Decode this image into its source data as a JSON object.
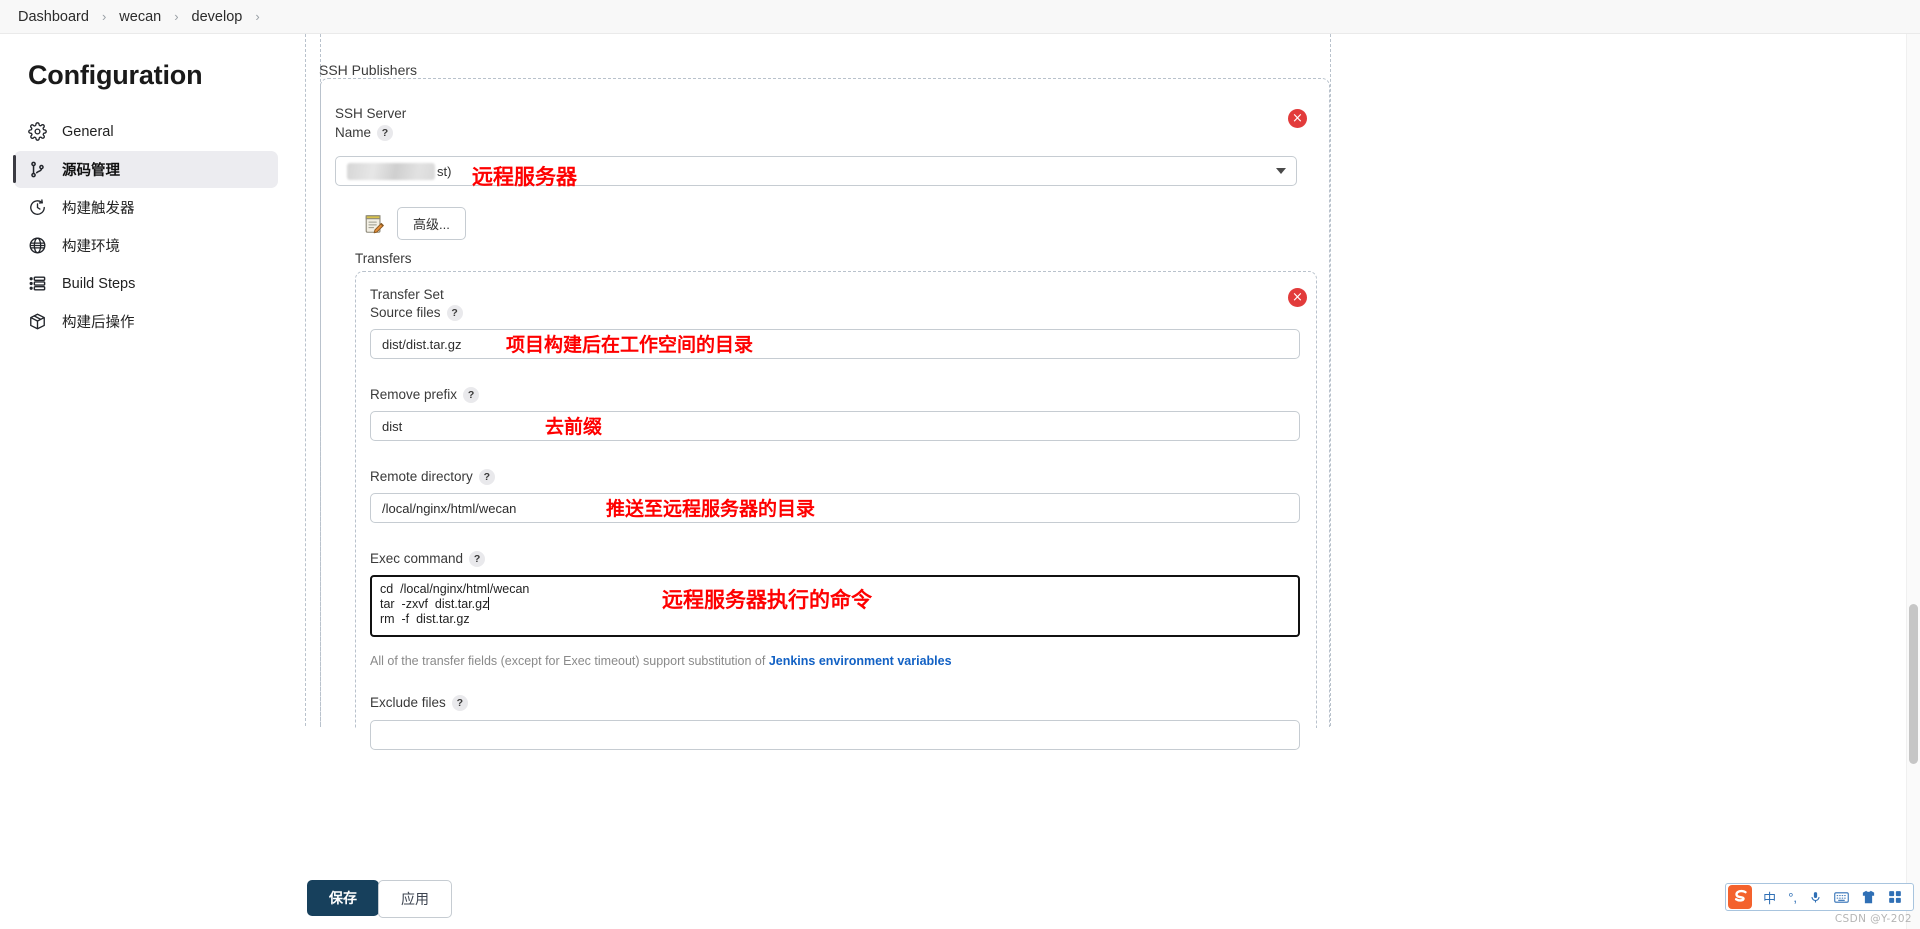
{
  "breadcrumb": {
    "items": [
      {
        "label": "Dashboard"
      },
      {
        "label": "wecan"
      },
      {
        "label": "develop"
      }
    ],
    "separator": "›"
  },
  "sidebar": {
    "title": "Configuration",
    "items": [
      {
        "label": "General",
        "icon": "gear-icon",
        "active": false
      },
      {
        "label": "源码管理",
        "icon": "source-branch-icon",
        "active": true
      },
      {
        "label": "构建触发器",
        "icon": "clock-icon",
        "active": false
      },
      {
        "label": "构建环境",
        "icon": "globe-icon",
        "active": false
      },
      {
        "label": "Build Steps",
        "icon": "list-steps-icon",
        "active": false
      },
      {
        "label": "构建后操作",
        "icon": "package-icon",
        "active": false
      }
    ]
  },
  "main": {
    "section_title": "SSH Publishers",
    "ssh_server": {
      "label_line1": "SSH Server",
      "label_line2": "Name",
      "help": "?",
      "selected_value_tail": "st)",
      "selected_value_redacted": true,
      "annotation": "远程服务器",
      "close_label": "×"
    },
    "advanced_button": "高级...",
    "transfers_label": "Transfers",
    "transfer_set": {
      "title": "Transfer Set",
      "close_label": "×",
      "fields": [
        {
          "label": "Source files",
          "help": "?",
          "value": "dist/dist.tar.gz",
          "annotation": "项目构建后在工作空间的目录"
        },
        {
          "label": "Remove prefix",
          "help": "?",
          "value": "dist",
          "annotation": "去前缀"
        },
        {
          "label": "Remote directory",
          "help": "?",
          "value": "/local/nginx/html/wecan",
          "annotation": "推送至远程服务器的目录"
        }
      ],
      "exec_command": {
        "label": "Exec command",
        "help": "?",
        "lines": [
          "cd  /local/nginx/html/wecan",
          "tar  -zxvf  dist.tar.gz",
          "rm  -f  dist.tar.gz"
        ],
        "annotation": "远程服务器执行的命令"
      },
      "substitution_note": {
        "text": "All of the transfer fields (except for Exec timeout) support substitution of ",
        "link": "Jenkins environment variables"
      },
      "exclude_files": {
        "label": "Exclude files",
        "help": "?",
        "value": ""
      }
    }
  },
  "actions": {
    "save": "保存",
    "apply": "应用"
  },
  "ime": {
    "logo": "sogou-logo-icon",
    "items": [
      {
        "icon": "chinese-mode-icon",
        "label": "中"
      },
      {
        "icon": "punctuation-icon",
        "label": "°,"
      },
      {
        "icon": "microphone-icon",
        "label": ""
      },
      {
        "icon": "keyboard-icon",
        "label": ""
      },
      {
        "icon": "skin-shirt-icon",
        "label": ""
      },
      {
        "icon": "toolbox-grid-icon",
        "label": ""
      }
    ]
  },
  "watermark": "CSDN @Y-202"
}
